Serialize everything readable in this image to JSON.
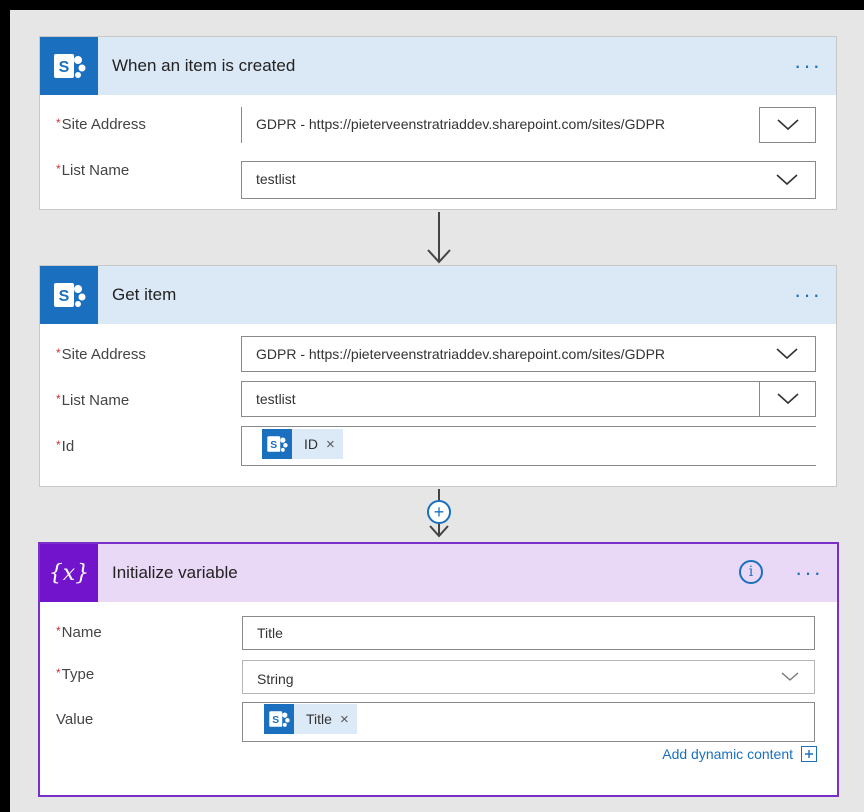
{
  "cards": [
    {
      "title": "When an item is created",
      "fields": [
        {
          "label": "Site Address",
          "value": "GDPR - https://pieterveenstratriaddev.sharepoint.com/sites/GDPR"
        },
        {
          "label": "List Name",
          "value": "testlist"
        }
      ]
    },
    {
      "title": "Get item",
      "fields": [
        {
          "label": "Site Address",
          "value": "GDPR - https://pieterveenstratriaddev.sharepoint.com/sites/GDPR"
        },
        {
          "label": "List Name",
          "value": "testlist"
        },
        {
          "label": "Id",
          "token": "ID"
        }
      ]
    },
    {
      "title": "Initialize variable",
      "icon_text": "{x}",
      "fields": [
        {
          "label": "Name",
          "value": "Title"
        },
        {
          "label": "Type",
          "value": "String"
        },
        {
          "label": "Value",
          "token": "Title"
        }
      ],
      "add_dynamic": "Add dynamic content"
    }
  ],
  "required_mark": "*",
  "more_glyph": "···",
  "info_glyph": "i",
  "plus_glyph": "+",
  "close_glyph": "×",
  "colors": {
    "sharepoint_blue": "#1a70be",
    "variable_purple": "#7214cc",
    "header_blue": "#dbe8f5",
    "header_purple": "#ead8f7"
  }
}
